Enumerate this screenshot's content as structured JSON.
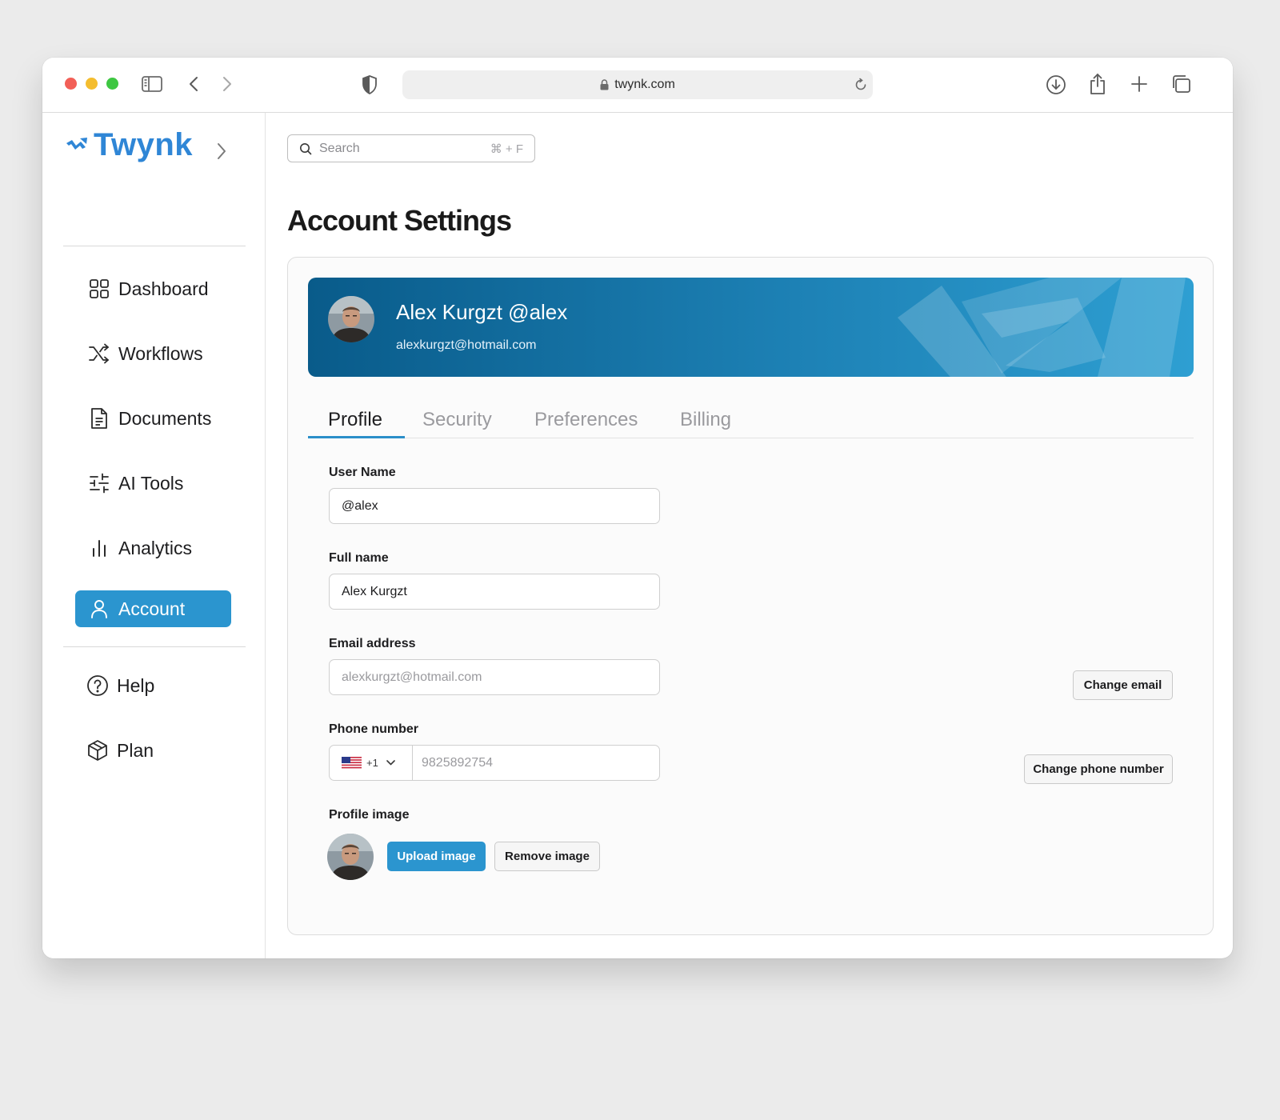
{
  "browser": {
    "url": "twynk.com"
  },
  "sidebar": {
    "logo": "Twynk",
    "items": [
      {
        "label": "Dashboard",
        "icon": "grid-icon"
      },
      {
        "label": "Workflows",
        "icon": "shuffle-icon"
      },
      {
        "label": "Documents",
        "icon": "document-icon"
      },
      {
        "label": "AI Tools",
        "icon": "sliders-icon"
      },
      {
        "label": "Analytics",
        "icon": "bar-chart-icon"
      },
      {
        "label": "Account",
        "icon": "user-icon",
        "active": true
      }
    ],
    "footer_items": [
      {
        "label": "Help",
        "icon": "help-circle-icon"
      },
      {
        "label": "Plan",
        "icon": "box-icon"
      }
    ]
  },
  "search": {
    "placeholder": "Search",
    "shortcut": "⌘ + F"
  },
  "page": {
    "title": "Account Settings"
  },
  "profile_banner": {
    "name": "Alex Kurgzt @alex",
    "email": "alexkurgzt@hotmail.com"
  },
  "tabs": [
    {
      "label": "Profile",
      "active": true
    },
    {
      "label": "Security"
    },
    {
      "label": "Preferences"
    },
    {
      "label": "Billing"
    }
  ],
  "form": {
    "username": {
      "label": "User Name",
      "value": "@alex"
    },
    "fullname": {
      "label": "Full name",
      "value": "Alex Kurgzt"
    },
    "email": {
      "label": "Email address",
      "value": "alexkurgzt@hotmail.com",
      "action": "Change email"
    },
    "phone": {
      "label": "Phone number",
      "country_code": "+1",
      "value": "9825892754",
      "action": "Change phone number"
    },
    "profile_image": {
      "label": "Profile image",
      "upload": "Upload image",
      "remove": "Remove image"
    }
  },
  "colors": {
    "accent": "#2b95cf",
    "logo": "#2f86d6",
    "banner_start": "#095b8a",
    "banner_end": "#2e9fd2"
  }
}
